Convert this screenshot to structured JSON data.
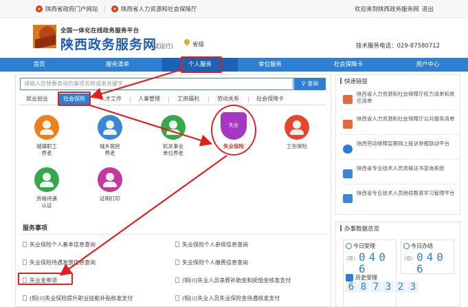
{
  "topbar": {
    "gov_portal": "陕西省政府门户网站",
    "hr_dept": "陕西省人力资源和社会保障厅",
    "welcome": "欢迎来到陕西政务服务网",
    "logout": "退出"
  },
  "header": {
    "subtitle": "全国一体化在线政务服务平台",
    "title": "陕西政务服务网",
    "trial": "(试运行)",
    "location": "省级",
    "hotline": "技术服务电话：029-87580712"
  },
  "nav": [
    "首页",
    "服务清单",
    "个人服务",
    "单位服务",
    "社会保障卡",
    "用户中心"
  ],
  "search": {
    "placeholder": "请输入您想要查询的事项名称或者关键字...",
    "button": "查询"
  },
  "tabs": [
    "就业创业",
    "社会保险",
    "人才工作",
    "人事管理",
    "工资福利",
    "劳动关系",
    "社会保障卡"
  ],
  "services": [
    {
      "line1": "城镇职工",
      "line2": "养老"
    },
    {
      "line1": "城乡居民",
      "line2": "养老"
    },
    {
      "line1": "机关事业",
      "line2": "单位养老"
    },
    {
      "line1": "失业保险",
      "line2": "",
      "badge": "失业"
    },
    {
      "line1": "工伤保险",
      "line2": ""
    },
    {
      "line1": "资格待遇",
      "line2": "认证"
    },
    {
      "line1": "证明打印",
      "line2": ""
    }
  ],
  "service_items": {
    "title": "服务事项",
    "items": [
      "失业保险个人基本信息查询",
      "失业保险个人参保信息查询",
      "失业保险待遇发放信息查询",
      "失业保险个人缴费信息查询",
      "失业金申领",
      "(铜川)失业人员丧葬补助金和抚恤金核准支付",
      "(铜川)失业保险提升职业技能补贴核准支付",
      "(铜川)失业人员失业保险金待遇核准支付"
    ]
  },
  "quick_links": {
    "title": "快速链接",
    "items": [
      "陕西省人力资源和社会保障厅权力清单和责任清单",
      "陕西省人力资源和社会保障厅公共服务清单",
      "陕西劳动保障监察网上投诉举报联动平台",
      "陕西省专业技术人员资格证书查询系统",
      "陕西省专业技术人员继续教育学习管理平台"
    ]
  },
  "stats": {
    "title": "办事数据总览",
    "today_accept": "今日受理",
    "today_done": "今日办结",
    "unit": "(项)",
    "today_accept_value": "0406",
    "today_done_value": "0406",
    "history_label": "历史受理",
    "history_value": "687323"
  },
  "colors": {
    "nav_blue": "#2f7fd0",
    "annotation_red": "#e21f1f",
    "icon_orange": "#f07f1a",
    "icon_blue": "#3b86d6",
    "icon_green": "#35a84a",
    "icon_purple": "#a637c2",
    "icon_red": "#e8452f",
    "icon_pink": "#c23a9e"
  }
}
